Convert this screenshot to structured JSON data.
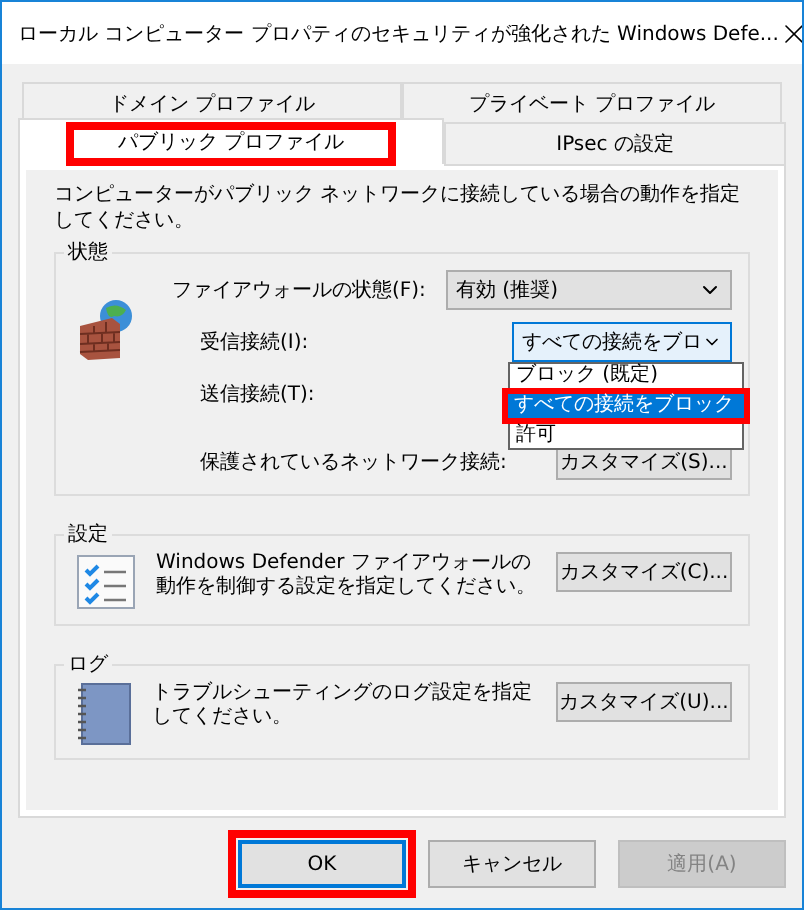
{
  "window": {
    "title": "ローカル コンピューター プロパティのセキュリティが強化された Windows Defe..."
  },
  "tab_rows": [
    [
      {
        "label": "ドメイン プロファイル",
        "selected": false,
        "highlighted": false
      },
      {
        "label": "プライベート プロファイル",
        "selected": false,
        "highlighted": false
      }
    ],
    [
      {
        "label": "パブリック プロファイル",
        "selected": true,
        "highlighted": true
      },
      {
        "label": "IPsec の設定",
        "selected": false,
        "highlighted": false
      }
    ]
  ],
  "description": "コンピューターがパブリック ネットワークに接続している場合の動作を指定してください。",
  "state_group": {
    "title": "状態",
    "firewall_state": {
      "label": "ファイアウォールの状態(F):",
      "value": "有効 (推奨)"
    },
    "inbound": {
      "label": "受信接続(I):",
      "value": "すべての接続をブロ",
      "open": true,
      "options": [
        {
          "label": "ブロック (既定)",
          "selected": false,
          "highlighted": false
        },
        {
          "label": "すべての接続をブロック",
          "selected": true,
          "highlighted": true
        },
        {
          "label": "許可",
          "selected": false,
          "highlighted": false
        }
      ]
    },
    "outbound": {
      "label": "送信接続(T):"
    },
    "protected": {
      "label": "保護されているネットワーク接続:",
      "button": "カスタマイズ(S)..."
    }
  },
  "settings_group": {
    "title": "設定",
    "text": "Windows Defender ファイアウォールの動作を制御する設定を指定してください。",
    "button": "カスタマイズ(C)..."
  },
  "log_group": {
    "title": "ログ",
    "text": "トラブルシューティングのログ設定を指定してください。",
    "button": "カスタマイズ(U)..."
  },
  "buttons": [
    {
      "label": "OK",
      "default": true,
      "disabled": false,
      "highlighted": true
    },
    {
      "label": "キャンセル",
      "default": false,
      "disabled": false,
      "highlighted": false
    },
    {
      "label": "適用(A)",
      "default": false,
      "disabled": true,
      "highlighted": false
    }
  ]
}
